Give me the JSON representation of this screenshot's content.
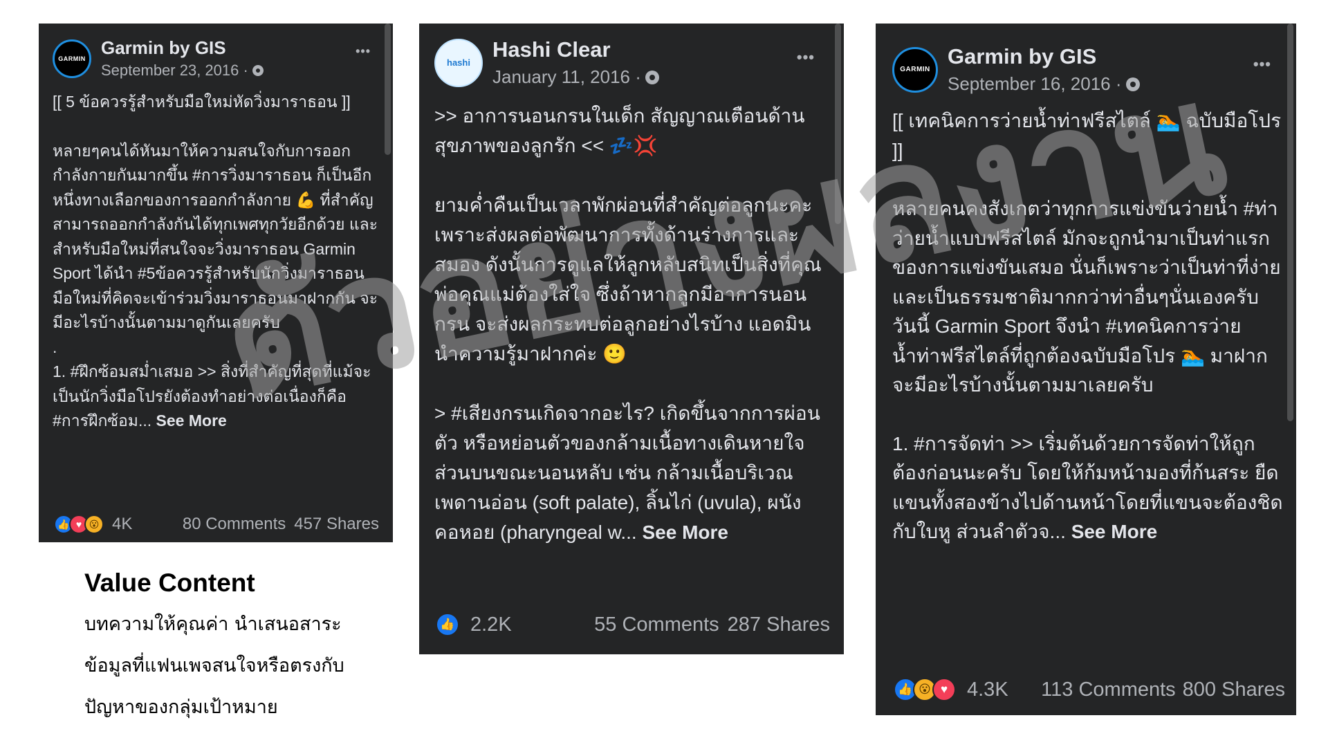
{
  "posts": [
    {
      "page_name": "Garmin by GIS",
      "avatar_text": "GARMIN",
      "date": "September 23, 2016 ·",
      "more_label": "•••",
      "paragraphs": [
        "[[ 5 ข้อควรรู้สำหรับมือใหม่หัดวิ่งมาราธอน ]]",
        "",
        "หลายๆคนได้หันมาให้ความสนใจกับการออกกำลังกายกันมากขึ้น #การวิ่งมาราธอน ก็เป็นอีกหนึ่งทางเลือกของการออกกำลังกาย 💪 ที่สำคัญสามารถออกกำลังกันได้ทุกเพศทุกวัยอีกด้วย และสำหรับมือใหม่ที่สนใจจะวิ่งมาราธอน Garmin Sport ได้นำ #5ข้อควรรู้สำหรับนักวิ่งมาราธอนมือใหม่ที่คิดจะเข้าร่วมวิ่งมาราธอนมาฝากกัน จะมีอะไรบ้างนั้นตามมาดูกันเลยครับ",
        ".",
        "1. #ฝึกซ้อมสม่ำเสมอ >> สิ่งที่สำคัญที่สุดที่แม้จะเป็นนักวิ่งมือโปรยังต้องทำอย่างต่อเนื่องก็คือ #การฝึกซ้อม..."
      ],
      "see_more": "See More",
      "reaction_count": "4K",
      "comments": "80 Comments",
      "shares": "457 Shares"
    },
    {
      "page_name": "Hashi Clear",
      "avatar_text": "hashi",
      "date": "January 11, 2016 ·",
      "more_label": "•••",
      "paragraphs": [
        ">> อาการนอนกรนในเด็ก สัญญาณเตือนด้านสุขภาพของลูกรัก << 💤💢",
        "",
        "ยามค่ำคืนเป็นเวลาพักผ่อนที่สำคัญต่อลูกนะคะ เพราะส่งผลต่อพัฒนาการทั้งด้านร่างการและสมอง ดังนั้นการดูแลให้ลูกหลับสนิทเป็นสิ่งที่คุณพ่อคุณแม่ต้องใส่ใจ ซึ่งถ้าหากลูกมีอาการนอนกรน จะส่งผลกระทบต่อลูกอย่างไรบ้าง แอดมินนำความรู้มาฝากค่ะ 🙂",
        "",
        "> #เสียงกรนเกิดจากอะไร? เกิดขึ้นจากการผ่อนตัว หรือหย่อนตัวของกล้ามเนื้อทางเดินหายใจส่วนบนขณะนอนหลับ เช่น กล้ามเนื้อบริเวณเพดานอ่อน (soft palate), ลิ้นไก่ (uvula), ผนังคอหอย (pharyngeal w..."
      ],
      "see_more": "See More",
      "reaction_count": "2.2K",
      "comments": "55 Comments",
      "shares": "287 Shares"
    },
    {
      "page_name": "Garmin by GIS",
      "avatar_text": "GARMIN",
      "date": "September 16, 2016 ·",
      "more_label": "•••",
      "paragraphs": [
        "[[ เทคนิคการว่ายน้ำท่าฟรีสไตล์ 🏊 ฉบับมือโปร ]]",
        "",
        "หลายคนคงสังเกตว่าทุกการแข่งขันว่ายน้ำ #ท่าว่ายน้ำแบบฟรีสไตล์ มักจะถูกนำมาเป็นท่าแรกของการแข่งขันเสมอ นั่นก็เพราะว่าเป็นท่าที่ง่ายและเป็นธรรมชาติมากกว่าท่าอื่นๆนั่นเองครับ วันนี้ Garmin Sport จึงนำ #เทคนิคการว่ายน้ำท่าฟรีสไตล์ที่ถูกต้องฉบับมือโปร 🏊 มาฝาก จะมีอะไรบ้างนั้นตามมาเลยครับ",
        "",
        "1. #การจัดท่า >> เริ่มต้นด้วยการจัดท่าให้ถูกต้องก่อนนะครับ โดยให้ก้มหน้ามองที่ก้นสระ ยืดแขนทั้งสองข้างไปด้านหน้าโดยที่แขนจะต้องชิดกับใบหู ส่วนลำตัวจ..."
      ],
      "see_more": "See More",
      "reaction_count": "4.3K",
      "comments": "113 Comments",
      "shares": "800 Shares"
    }
  ],
  "caption": {
    "title": "Value Content",
    "lines": [
      "บทความให้คุณค่า  นำเสนอสาระ",
      "ข้อมูลที่แฟนเพจสนใจหรือตรงกับ",
      "ปัญหาของกลุ่มเป้าหมาย"
    ]
  },
  "watermark": "ตัวอย่างผลงาน",
  "colors": {
    "card_bg": "#242526",
    "text": "#e4e6eb",
    "muted": "#b0b3b8",
    "like": "#1877f2",
    "love": "#f33e58",
    "wow": "#f7b125"
  }
}
